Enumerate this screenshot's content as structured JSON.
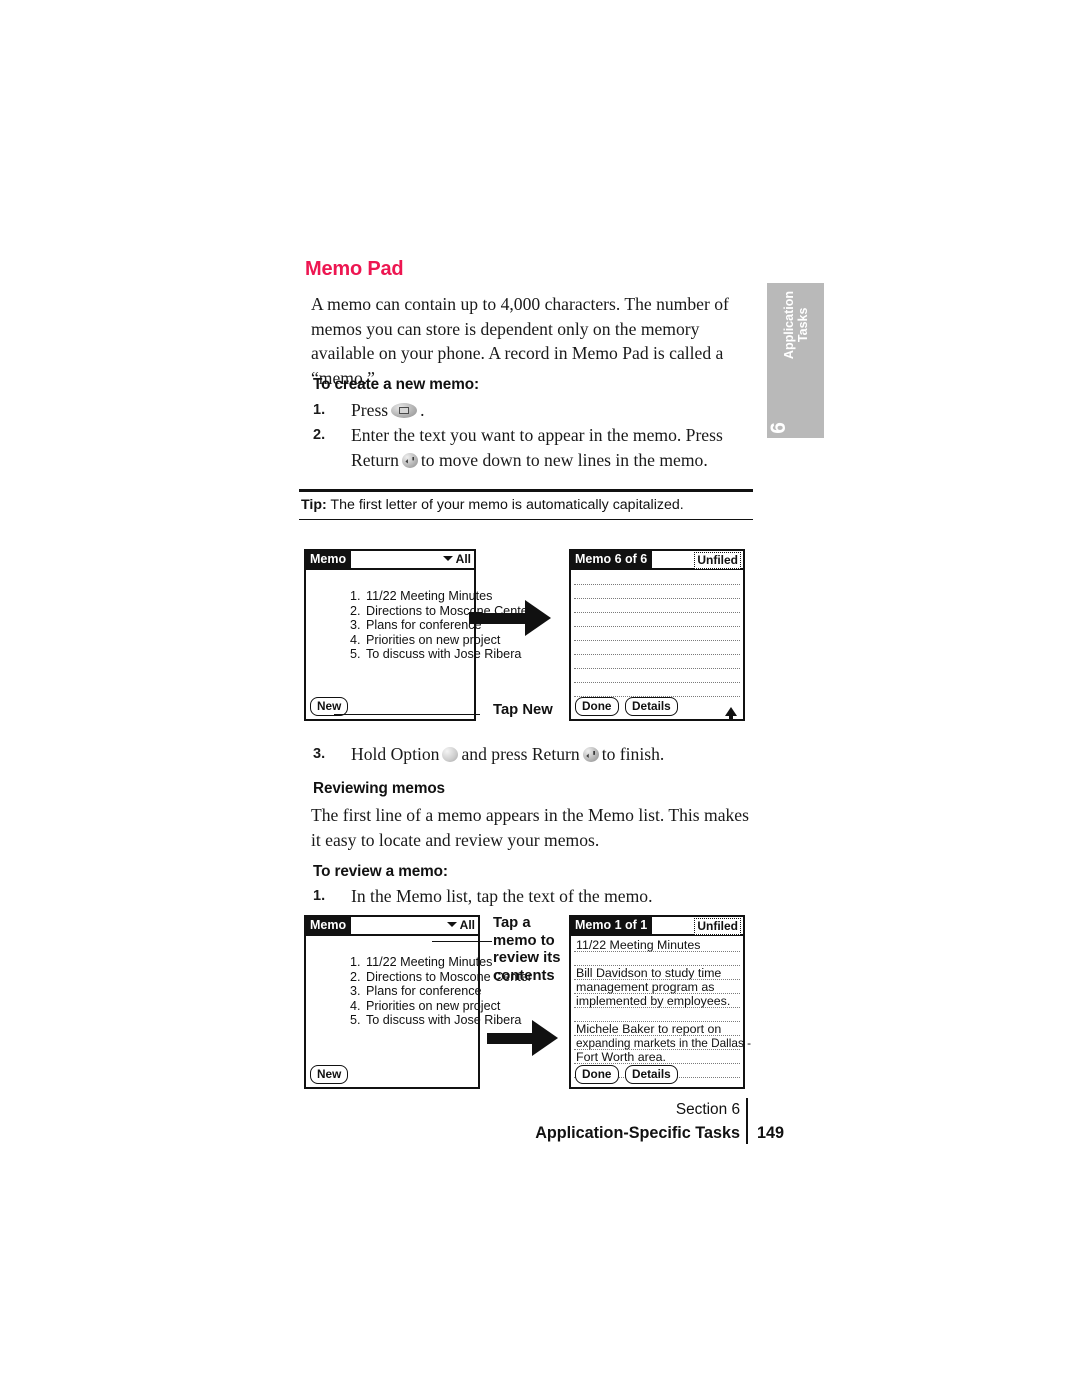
{
  "section_tab": {
    "label": "Application\nTasks",
    "number": "6",
    "bg_color": "#b9b9b9"
  },
  "heading": {
    "title": "Memo Pad",
    "color": "#ed1651"
  },
  "intro_paragraph": "A memo can contain up to 4,000 characters. The number of memos you can store is dependent only on the memory available on your phone. A record in Memo Pad is called a “memo.”",
  "create_memo": {
    "heading": "To create a new memo:",
    "step1_num": "1.",
    "step1_before": "Press",
    "step1_after": ".",
    "step2_num": "2.",
    "step2_before": "Enter the text you want to appear in the memo. Press Return",
    "step2_after": "to move down to new lines in the memo."
  },
  "tip": {
    "label": "Tip:",
    "text": " The first letter of your memo is automatically capitalized."
  },
  "figure1": {
    "left_screen": {
      "title": "Memo",
      "category": "All",
      "items": [
        {
          "idx": "1.",
          "text": "11/22 Meeting Minutes"
        },
        {
          "idx": "2.",
          "text": "Directions to Moscone Center"
        },
        {
          "idx": "3.",
          "text": "Plans for conference"
        },
        {
          "idx": "4.",
          "text": "Priorities on new project"
        },
        {
          "idx": "5.",
          "text": "To discuss with Jose Ribera"
        }
      ],
      "new_button": "New"
    },
    "callout": "Tap New",
    "right_screen": {
      "title": "Memo 6 of 6",
      "category": "Unfiled",
      "body_lines": [],
      "done_button": "Done",
      "details_button": "Details"
    }
  },
  "step3": {
    "num": "3.",
    "before": "Hold Option",
    "middle": "and press Return",
    "after": "to finish."
  },
  "reviewing": {
    "heading": "Reviewing memos",
    "paragraph": "The first line of a memo appears in the Memo list. This makes it easy to locate and review your memos.",
    "subheading": "To review a memo:",
    "step1_num": "1.",
    "step1_text": "In the Memo list, tap the text of the memo."
  },
  "figure2": {
    "left_screen": {
      "title": "Memo",
      "category": "All",
      "items": [
        {
          "idx": "1.",
          "text": "11/22 Meeting Minutes"
        },
        {
          "idx": "2.",
          "text": "Directions to Moscone Center"
        },
        {
          "idx": "3.",
          "text": "Plans for conference"
        },
        {
          "idx": "4.",
          "text": "Priorities on new project"
        },
        {
          "idx": "5.",
          "text": "To discuss with Jose Ribera"
        }
      ],
      "new_button": "New"
    },
    "callout": "Tap a\nmemo to\nreview its\ncontents",
    "right_screen": {
      "title": "Memo 1 of 1",
      "category": "Unfiled",
      "body_lines": [
        "11/22 Meeting Minutes",
        "",
        "Bill Davidson to study time",
        "management program as",
        "implemented by employees.",
        "",
        "Michele Baker to report on",
        "expanding markets in the Dallas -",
        "Fort Worth area."
      ],
      "done_button": "Done",
      "details_button": "Details"
    }
  },
  "footer": {
    "section": "Section 6",
    "title": "Application-Specific Tasks",
    "page": "149"
  }
}
